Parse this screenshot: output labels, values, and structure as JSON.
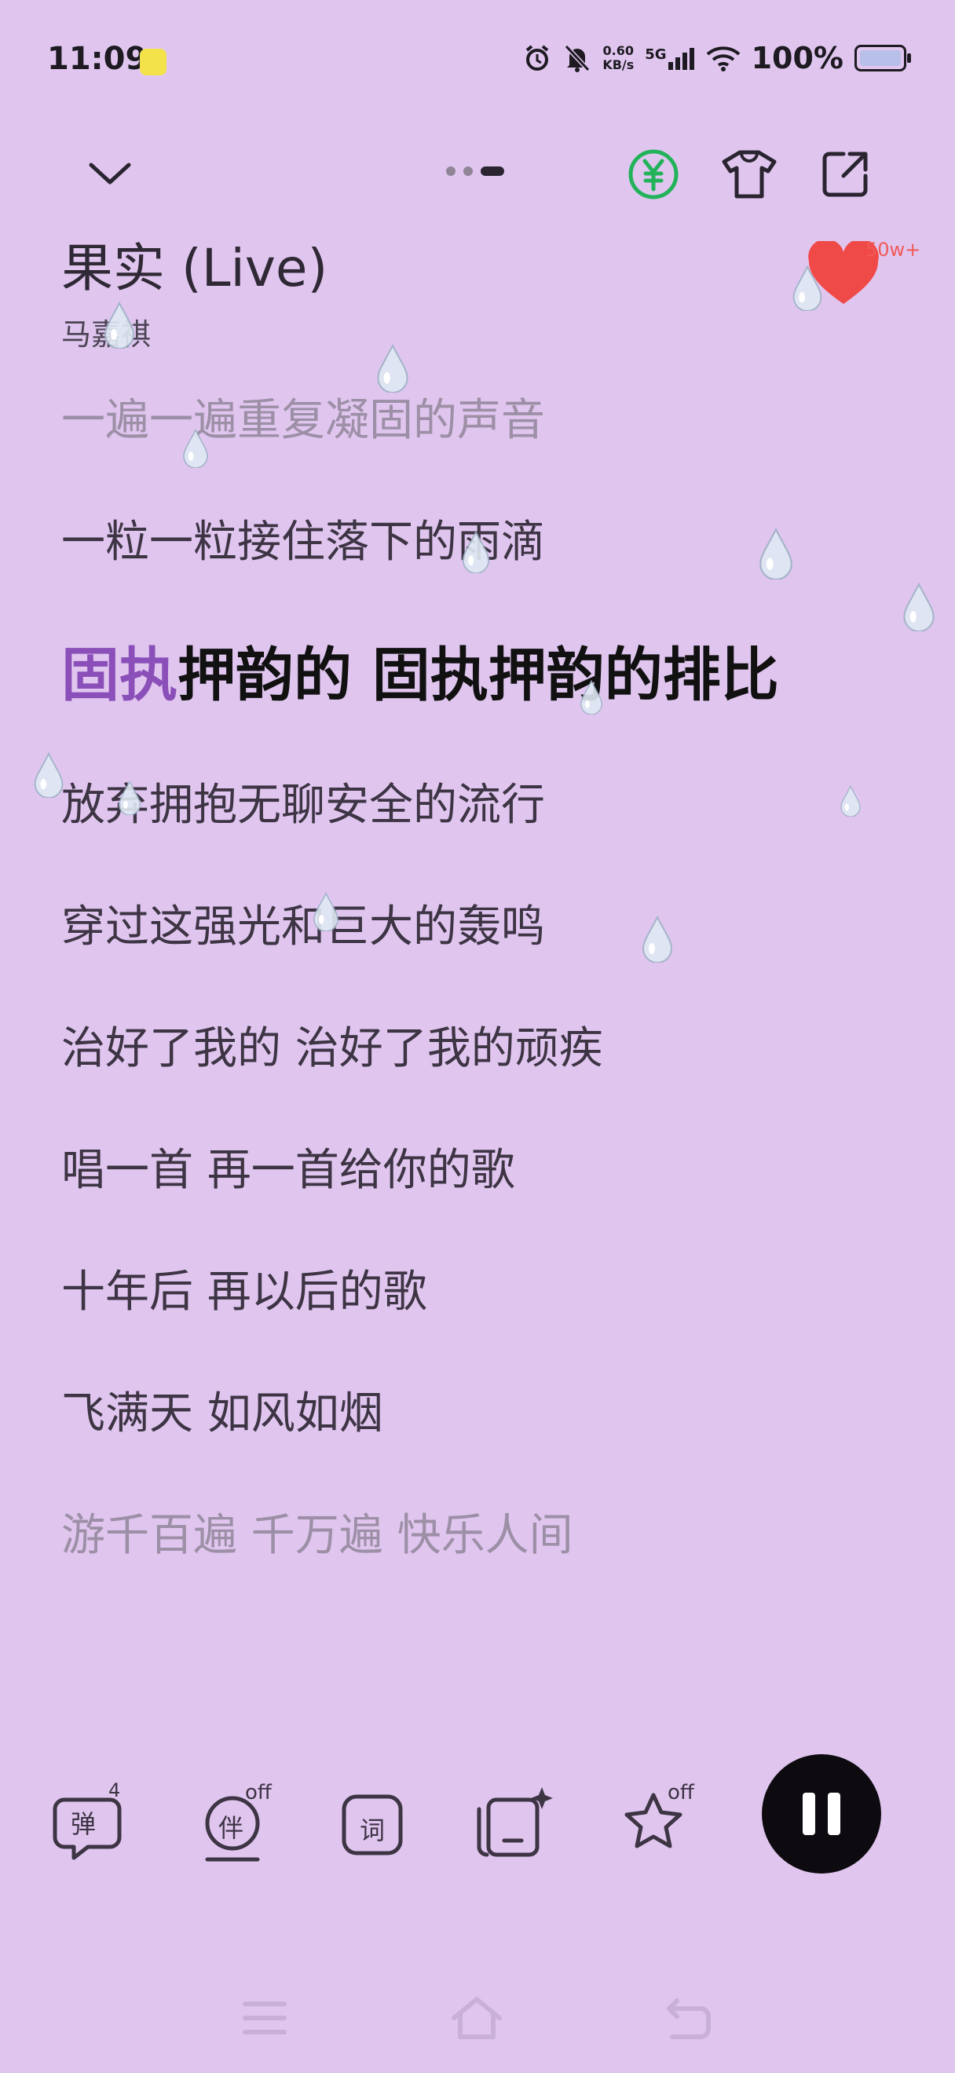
{
  "status_bar": {
    "time": "11:09",
    "net_speed_value": "0.60",
    "net_speed_unit": "KB/s",
    "network": "5G",
    "battery": "100%"
  },
  "player": {
    "title": "果实 (Live)",
    "artist": "马嘉祺",
    "like_count": "50w+",
    "current_line_highlighted": "固执",
    "current_line_rest": "押韵的 固执押韵的排比",
    "lyrics_before": [
      "一遍一遍重复凝固的声音",
      "一粒一粒接住落下的雨滴"
    ],
    "lyrics_after": [
      "放弃拥抱无聊安全的流行",
      "穿过这强光和巨大的轰鸣",
      "治好了我的 治好了我的顽疾",
      "唱一首 再一首给你的歌",
      "十年后 再以后的歌",
      "飞满天 如风如烟",
      "游千百遍 千万遍 快乐人间"
    ]
  },
  "controls": {
    "danmu_label": "弹",
    "danmu_count": "4",
    "accompany_label": "伴",
    "accompany_state": "off",
    "lyrics_label": "词",
    "favorite_state": "off"
  },
  "colors": {
    "background": "#e0c6ef",
    "highlight": "#8a4fb8",
    "like": "#f05a57",
    "vip_green": "#22b35a"
  }
}
